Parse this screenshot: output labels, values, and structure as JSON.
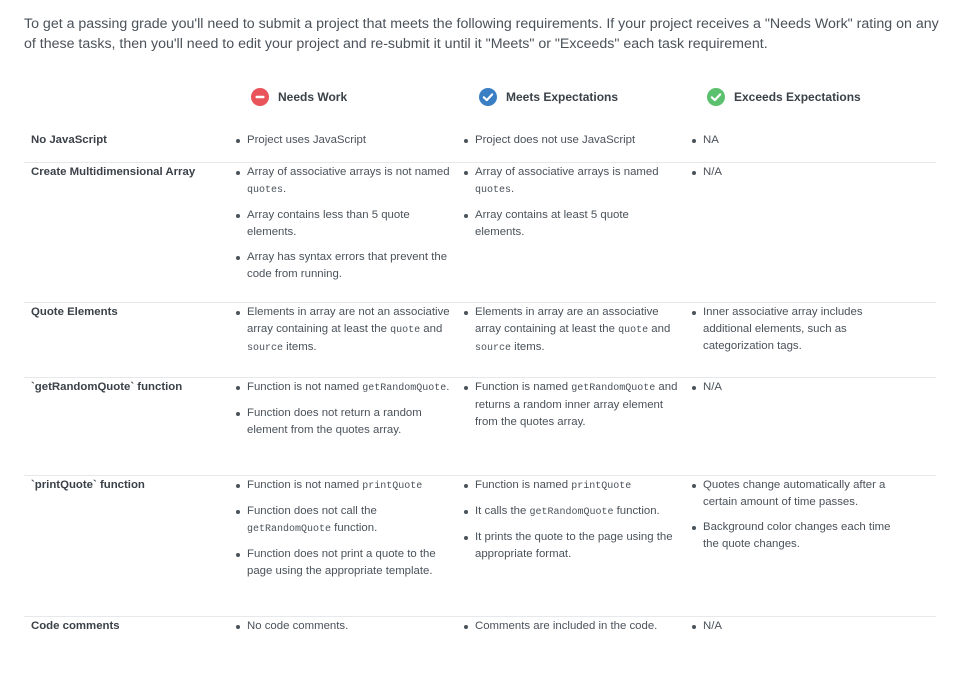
{
  "intro": "To get a passing grade you'll need to submit a project that meets the following requirements. If your project receives a \"Needs Work\" rating on any of these tasks, then you'll need to edit your project and re-submit it until it \"Meets\" or \"Exceeds\" each task requirement.",
  "columns": {
    "needs_work": {
      "label": "Needs Work",
      "icon": "minus-circle-icon",
      "color": "#e8545a"
    },
    "meets": {
      "label": "Meets Expectations",
      "icon": "check-circle-icon",
      "color": "#3a7fc4"
    },
    "exceeds": {
      "label": "Exceeds Expectations",
      "icon": "check-circle-icon",
      "color": "#5cc16e"
    }
  },
  "rows": [
    {
      "label": "No JavaScript",
      "needs_work": [
        "Project uses JavaScript"
      ],
      "meets": [
        "Project does not use JavaScript"
      ],
      "exceeds": [
        "NA"
      ]
    },
    {
      "label": "Create Multidimensional Array",
      "needs_work": [
        [
          {
            "t": "Array of associative arrays is not named "
          },
          {
            "c": "quotes"
          },
          {
            "t": "."
          }
        ],
        "Array contains less than 5 quote elements.",
        "Array has syntax errors that prevent the code from running."
      ],
      "meets": [
        [
          {
            "t": "Array of associative arrays is named "
          },
          {
            "c": "quotes"
          },
          {
            "t": "."
          }
        ],
        "Array contains at least 5 quote elements."
      ],
      "exceeds": [
        "N/A"
      ]
    },
    {
      "label": "Quote Elements",
      "needs_work": [
        [
          {
            "t": "Elements in array are not an associative array containing at least the "
          },
          {
            "c": "quote"
          },
          {
            "t": " and "
          },
          {
            "c": "source"
          },
          {
            "t": " items."
          }
        ]
      ],
      "meets": [
        [
          {
            "t": "Elements in array are an associative array containing at least the "
          },
          {
            "c": "quote"
          },
          {
            "t": " and "
          },
          {
            "c": "source"
          },
          {
            "t": " items."
          }
        ]
      ],
      "exceeds": [
        "Inner associative array includes additional elements, such as categorization tags."
      ]
    },
    {
      "label": "`getRandomQuote` function",
      "needs_work": [
        [
          {
            "t": "Function is not named "
          },
          {
            "c": "getRandomQuote"
          },
          {
            "t": "."
          }
        ],
        "Function does not return a random element from the quotes array."
      ],
      "meets": [
        [
          {
            "t": "Function is named "
          },
          {
            "c": "getRandomQuote"
          },
          {
            "t": " and returns a random inner array element from the quotes array."
          }
        ]
      ],
      "exceeds": [
        "N/A"
      ]
    },
    {
      "label": "`printQuote` function",
      "needs_work": [
        [
          {
            "t": "Function is not named "
          },
          {
            "c": "printQuote"
          }
        ],
        [
          {
            "t": "Function does not call the "
          },
          {
            "c": "getRandomQuote"
          },
          {
            "t": " function."
          }
        ],
        "Function does not print a quote to the page using the appropriate template."
      ],
      "meets": [
        [
          {
            "t": "Function is named "
          },
          {
            "c": "printQuote"
          }
        ],
        [
          {
            "t": "It calls the "
          },
          {
            "c": "getRandomQuote"
          },
          {
            "t": " function."
          }
        ],
        "It prints the quote to the page using the appropriate format."
      ],
      "exceeds": [
        "Quotes change automatically after a certain amount of time passes.",
        "Background color changes each time the quote changes."
      ]
    },
    {
      "label": "Code comments",
      "needs_work": [
        "No code comments."
      ],
      "meets": [
        "Comments are included in the code."
      ],
      "exceeds": [
        "N/A"
      ]
    }
  ]
}
